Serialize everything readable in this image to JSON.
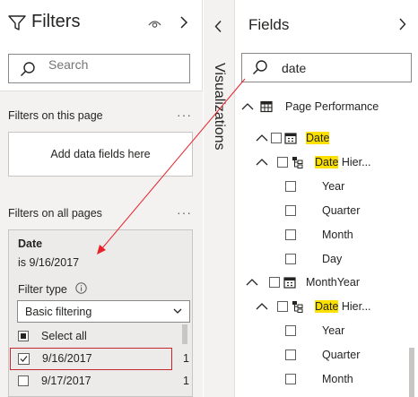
{
  "filters": {
    "title": "Filters",
    "search_placeholder": "Search",
    "section_this_page": "Filters on this page",
    "add_fields": "Add data fields here",
    "section_all_pages": "Filters on all pages",
    "more": "···",
    "card": {
      "title": "Date",
      "summary": "is 9/16/2017",
      "filter_type_label": "Filter type",
      "filter_type_value": "Basic filtering",
      "options": [
        {
          "label": "Select all",
          "count": ""
        },
        {
          "label": "9/16/2017",
          "count": "1"
        },
        {
          "label": "9/17/2017",
          "count": "1"
        }
      ]
    }
  },
  "visualizations": {
    "label": "Visualizations"
  },
  "fields": {
    "title": "Fields",
    "search_value": "date",
    "tree": [
      {
        "text": "Page Performance",
        "hl": ""
      },
      {
        "text": "",
        "hl": "Date"
      },
      {
        "text": " Hier...",
        "hl": "Date"
      },
      {
        "text": "Year",
        "hl": ""
      },
      {
        "text": "Quarter",
        "hl": ""
      },
      {
        "text": "Month",
        "hl": ""
      },
      {
        "text": "Day",
        "hl": ""
      },
      {
        "text": "MonthYear",
        "hl": ""
      },
      {
        "text": " Hier...",
        "hl": "Date"
      },
      {
        "text": "Year",
        "hl": ""
      },
      {
        "text": "Quarter",
        "hl": ""
      },
      {
        "text": "Month",
        "hl": ""
      }
    ]
  },
  "colors": {
    "highlight": "#fce100",
    "selection_border": "#c4262e",
    "arrow": "#e8202a"
  }
}
